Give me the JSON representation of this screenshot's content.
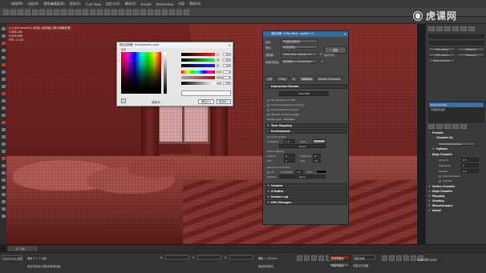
{
  "menubar": {
    "items": [
      "修改(M)",
      "动画(A)",
      "图形编辑器(D)",
      "渲染(R)",
      "Civil View",
      "自定义(U)",
      "脚本(S)",
      "Arnold",
      "Interactive",
      "内容",
      "帮助(H)"
    ]
  },
  "viewport": {
    "name": "[+] [Camera001] [标准] [高质量] [默认明暗处理]",
    "stats_polys": "1,806,182",
    "stats_verts": "4,594,609",
    "fps_label": "FPS:",
    "fps_value": "2.102"
  },
  "color_picker": {
    "title": "颜色选择器: environment_color",
    "hue_label": "色调",
    "whiteness_label": "白度",
    "blackness_label": "黑度",
    "channels": [
      {
        "label": "红:",
        "value": "165",
        "color": "#ff6060"
      },
      {
        "label": "绿:",
        "value": "165",
        "color": "#60ff60"
      },
      {
        "label": "蓝:",
        "value": "165",
        "color": "#6060ff"
      },
      {
        "label": "色调:",
        "value": "0",
        "color": "#ffcc00"
      },
      {
        "label": "饱和度:",
        "value": "0",
        "color": "#bbbbbb"
      },
      {
        "label": "亮度:",
        "value": "165",
        "color": "#999999"
      }
    ],
    "reset_label": "重置(R)",
    "ok_label": "确定(O)",
    "cancel_label": "取消(C)"
  },
  "render_setup": {
    "title": "渲染设置: V-Ray Next, update 1.2",
    "target_label": "目标:",
    "target_value": "产品级渲染模式",
    "preset_label": "预设:",
    "preset_value": "未选定预设",
    "renderer_label": "渲染器:",
    "renderer_value": "V-Ray Next, update 1.2",
    "save_file_label": "保存文件",
    "view_label": "查看到渲染:",
    "view_value": "四元菜单 4 - Camera001",
    "render_button": "渲染",
    "tabs": [
      "公用",
      "V-Ray",
      "GI",
      "Settings",
      "Render Elements"
    ],
    "sections": {
      "interactive": "Interactive Render",
      "ipr_label": "Start IPR",
      "fit_label": "Fit resolution to VFB",
      "force_prog_label": "Force progressive sampling",
      "use_ipr_label": "Use interactive engine",
      "upd_label": "Update during changes",
      "render_size_label": "Render size:",
      "render_size_value": "800x600",
      "tone_mapping": "Tone Mapping",
      "environment": "Environment",
      "gi_env": "GI environment",
      "reflect_env": "Reflection/refraction environment",
      "refract_env": "Refraction environment",
      "secondary_matte": "Secondary matte environment",
      "multiplier_label": "multiplier",
      "multiplier_value": "1.0",
      "color_label": "color",
      "none_label": "None",
      "direct_lighting": "Direct lighting",
      "sampling_label": "sampling",
      "sampling_value": "8",
      "sampling_min": "min",
      "sampling_max": "max",
      "sampling_min_value": "1",
      "sampling_max_value": "24",
      "subdivs_label": "subdivs",
      "subdivs_value": "8",
      "raylength_label": "ray length",
      "alpha": "Alpha environment",
      "alpha_on": "On",
      "alpha_mult": "multiplier",
      "alpha_mult_value": "1.0",
      "alpha_color": "color",
      "alpha_texture": "texture",
      "alpha_none": "None",
      "camera": "Camera",
      "gbuffer": "G-Buffer",
      "render_log": "Render Log",
      "gpu_manager": "GPU Manager"
    }
  },
  "command_panel": {
    "list_items": [
      "Pine Chamfer",
      "可编辑多边形"
    ],
    "buttons": [
      "FFD 4x4x4",
      "FFD(box)",
      "FFD 2x2x2",
      "FFD(cyl)",
      "Pine Chamfer"
    ],
    "presets_label": "Presets",
    "chamfer_by_label": "Chamfer By",
    "chamfer_by_value": "Smoothing Groups",
    "options_label": "Options",
    "edge_chamfer": "Edge Chamfer",
    "amount_label": "Amount",
    "amount_value": "0.5",
    "segments_label": "Segments",
    "segments_value": "2",
    "tension_label": "Tension",
    "tension_value": "0.5",
    "use_intersects": "Use Intersects",
    "smooth_label": "Smooth",
    "sections": [
      "Vertex Chamfer",
      "Edge Chamfer",
      "Mapping",
      "Shading",
      "Miscellaneous",
      "About"
    ]
  },
  "bottom": {
    "selection": "选择了 1 个 对象",
    "hint": "单击并拖动以选择并移动对象",
    "frame": "0 / 100",
    "x_label": "X:",
    "y_label": "Y:",
    "z_label": "Z:",
    "grid": "栅格 = 10.0mm",
    "add_time_tag": "添加时间标记",
    "auto_key": "自动关键点",
    "set_key": "设置关键点",
    "selected": "选定对象",
    "key_filters": "关键点过滤器...",
    "maxscript": "MAXScript 迷你"
  },
  "watermark": {
    "text": "虎课网",
    "url": "huke88.com"
  }
}
